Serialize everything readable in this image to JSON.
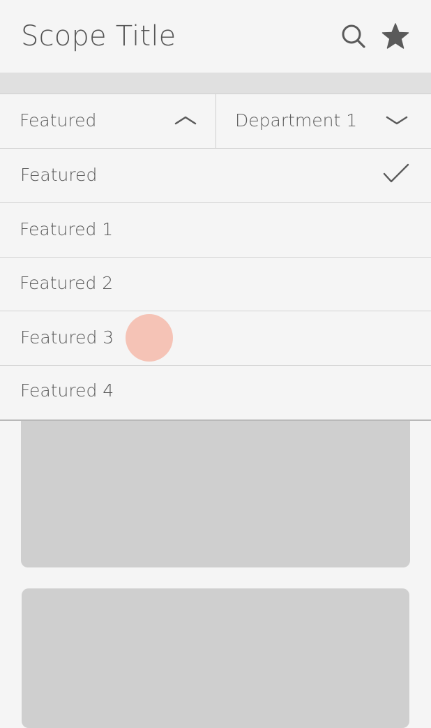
{
  "header": {
    "title": "Scope Title",
    "icons": [
      "search-icon",
      "star-icon"
    ]
  },
  "filters": {
    "left": {
      "label": "Featured",
      "state": "expanded"
    },
    "right": {
      "label": "Department 1",
      "state": "collapsed"
    }
  },
  "dropdown": {
    "selected_index": 0,
    "options": [
      {
        "label": "Featured"
      },
      {
        "label": "Featured 1"
      },
      {
        "label": "Featured 2"
      },
      {
        "label": "Featured 3"
      },
      {
        "label": "Featured 4"
      }
    ]
  },
  "colors": {
    "background": "#f5f5f5",
    "band": "#e0e0e0",
    "text": "#5d5d5d",
    "card": "#cfcfcf",
    "touch": "#f5c3b6"
  }
}
